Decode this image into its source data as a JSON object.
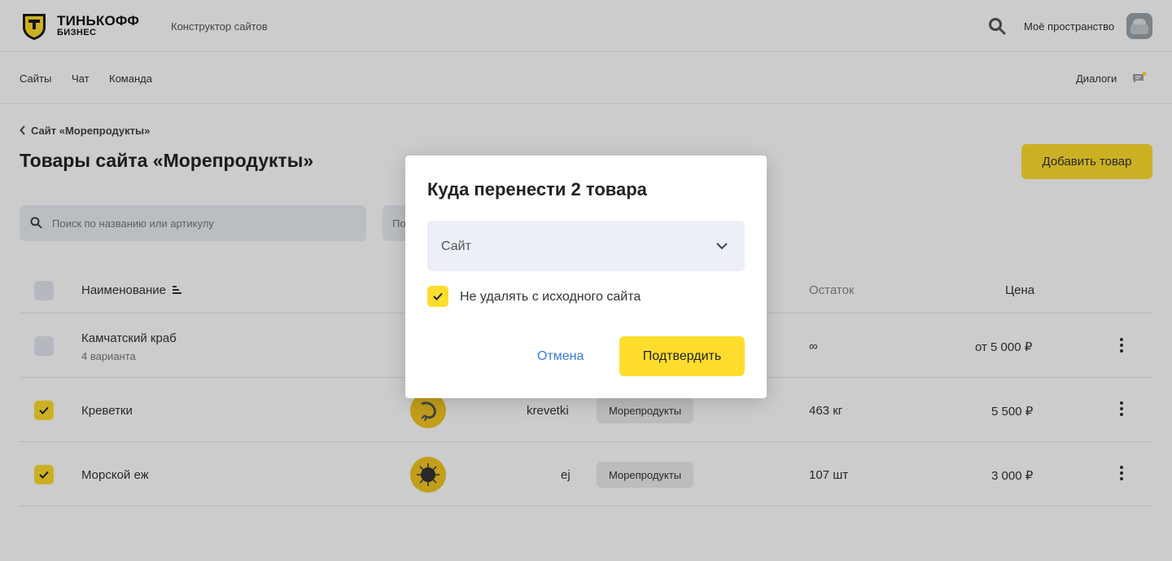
{
  "header": {
    "brand_line1": "ТИНЬКОФФ",
    "brand_line2": "БИЗНЕС",
    "product": "Конструктор сайтов",
    "workspace": "Моё пространство"
  },
  "nav": {
    "items": [
      "Сайты",
      "Чат",
      "Команда"
    ],
    "dialogs": "Диалоги"
  },
  "page": {
    "breadcrumb": "Сайт «Морепродукты»",
    "title": "Товары сайта «Морепродукты»",
    "add_button": "Добавить товар",
    "search_placeholder": "Поиск по названию или артикулу",
    "filter_placeholder": "По"
  },
  "table": {
    "columns": {
      "name": "Наименование",
      "stock": "Остаток",
      "price": "Цена"
    },
    "rows": [
      {
        "name": "Камчатский краб",
        "variants": "4 варианта",
        "sku": "",
        "site": "",
        "stock": "∞",
        "price": "от 5 000 ₽",
        "checked": false
      },
      {
        "name": "Креветки",
        "variants": "",
        "sku": "krevetki",
        "site": "Морепродукты",
        "stock": "463 кг",
        "price": "5 500 ₽",
        "checked": true
      },
      {
        "name": "Морской еж",
        "variants": "",
        "sku": "ej",
        "site": "Морепродукты",
        "stock": "107 шт",
        "price": "3 000 ₽",
        "checked": true
      }
    ]
  },
  "dialog": {
    "title": "Куда перенести 2 товара",
    "select_label": "Сайт",
    "checkbox_label": "Не удалять с исходного сайта",
    "checkbox_checked": true,
    "cancel": "Отмена",
    "confirm": "Подтвердить"
  },
  "colors": {
    "accent": "#ffdd2d",
    "link": "#3a7bd5",
    "field_bg": "#eceff5"
  }
}
